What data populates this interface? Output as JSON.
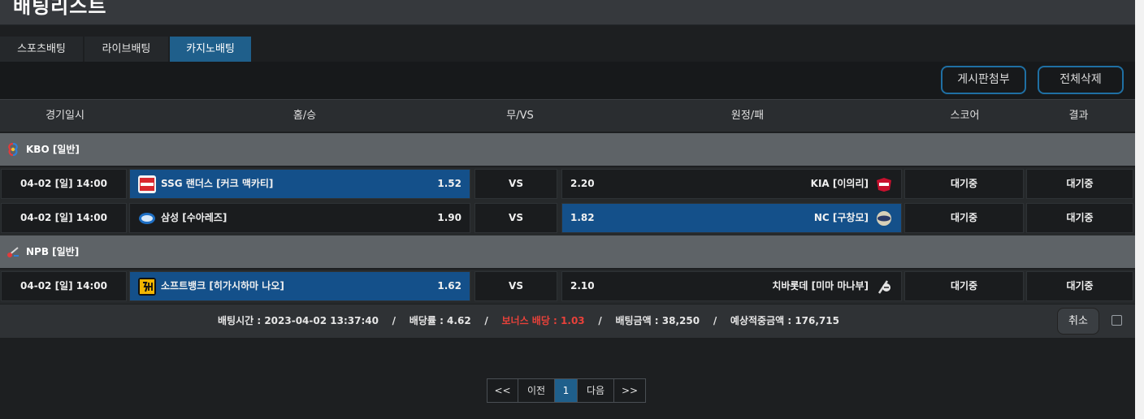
{
  "page": {
    "title": "배팅리스트"
  },
  "tabs": [
    {
      "label": "스포츠배팅",
      "active": false
    },
    {
      "label": "라이브배팅",
      "active": false
    },
    {
      "label": "카지노배팅",
      "active": true
    }
  ],
  "toolbar": {
    "board_attach_label": "게시판첨부",
    "delete_all_label": "전체삭제"
  },
  "columns": {
    "date": "경기일시",
    "home": "홈/승",
    "draw": "무/VS",
    "away": "원정/패",
    "score": "스코어",
    "result": "결과"
  },
  "leagues": [
    {
      "name": "KBO [일반]",
      "icon": "kbo-icon",
      "games": [
        {
          "date": "04-02 [일] 14:00",
          "home_team": "SSG 랜더스 [커크 맥카티]",
          "home_odds": "1.52",
          "draw": "VS",
          "away_odds": "2.20",
          "away_team": "KIA [이의리]",
          "score": "대기중",
          "result": "대기중",
          "selected": "home"
        },
        {
          "date": "04-02 [일] 14:00",
          "home_team": "삼성 [수아레즈]",
          "home_odds": "1.90",
          "draw": "VS",
          "away_odds": "1.82",
          "away_team": "NC [구창모]",
          "score": "대기중",
          "result": "대기중",
          "selected": "away"
        }
      ]
    },
    {
      "name": "NPB [일반]",
      "icon": "npb-icon",
      "games": [
        {
          "date": "04-02 [일] 14:00",
          "home_team": "소프트뱅크 [히가시하마 나오]",
          "home_odds": "1.62",
          "draw": "VS",
          "away_odds": "2.10",
          "away_team": "치바롯데 [미마 마나부]",
          "score": "대기중",
          "result": "대기중",
          "selected": "home"
        }
      ]
    }
  ],
  "summary": {
    "bet_time": "배팅시간 : 2023-04-02 13:37:40",
    "odds": "배당률 : 4.62",
    "bonus": "보너스 배당 : 1.03",
    "amount": "배팅금액 : 38,250",
    "expected": "예상적중금액 : 176,715",
    "separator": "/",
    "cancel_label": "취소"
  },
  "pagination": {
    "first": "<<",
    "prev": "이전",
    "current": "1",
    "next": "다음",
    "last": ">>"
  },
  "colors": {
    "accent": "#1f5f8b",
    "selected_cell": "#14508a",
    "bonus_text": "#e8413a",
    "button_border": "#1f6fa3"
  }
}
